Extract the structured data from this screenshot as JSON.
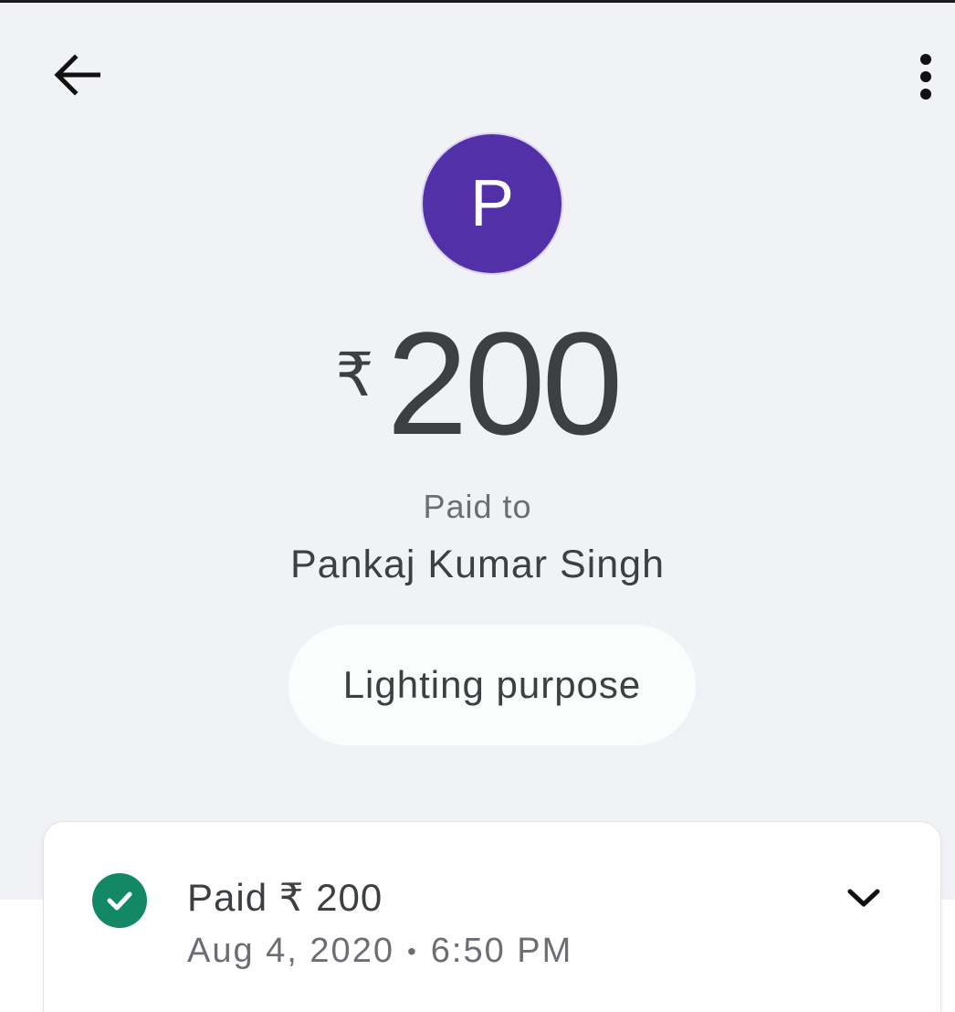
{
  "header": {
    "back_icon": "arrow-left-icon",
    "menu_icon": "more-vertical-icon"
  },
  "avatar": {
    "letter": "P",
    "color": "#5230a8"
  },
  "transaction": {
    "currency_symbol": "₹",
    "amount": "200",
    "paid_to_label": "Paid to",
    "payee_name": "Pankaj Kumar Singh",
    "note": "Lighting purpose"
  },
  "status_card": {
    "status_icon": "check-circle-icon",
    "status_color": "#138864",
    "title": "Paid ₹ 200",
    "date": "Aug 4, 2020",
    "separator": "•",
    "time": "6:50 PM",
    "expand_icon": "chevron-down-icon"
  }
}
